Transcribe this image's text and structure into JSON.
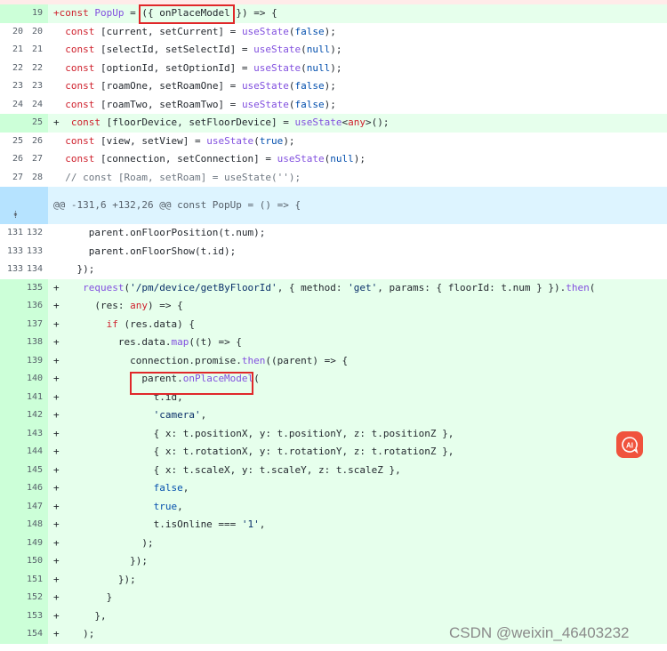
{
  "lines_before": [
    {
      "old": "",
      "new": "19",
      "type": "add",
      "segs": [
        [
          "+const ",
          "kw"
        ],
        [
          "PopUp",
          "fn"
        ],
        [
          " = ",
          ""
        ],
        [
          "({ onPlaceModel })",
          ""
        ],
        [
          " => {",
          ""
        ]
      ]
    },
    {
      "old": "20",
      "new": "20",
      "type": "ctx",
      "segs": [
        [
          "  const ",
          "kw"
        ],
        [
          "[current, setCurrent] = ",
          ""
        ],
        [
          "useState",
          "fn"
        ],
        [
          "(",
          ""
        ],
        [
          "false",
          "bl"
        ],
        [
          ");",
          ""
        ]
      ]
    },
    {
      "old": "21",
      "new": "21",
      "type": "ctx",
      "segs": [
        [
          "  const ",
          "kw"
        ],
        [
          "[selectId, setSelectId] = ",
          ""
        ],
        [
          "useState",
          "fn"
        ],
        [
          "(",
          ""
        ],
        [
          "null",
          "bl"
        ],
        [
          ");",
          ""
        ]
      ]
    },
    {
      "old": "22",
      "new": "22",
      "type": "ctx",
      "segs": [
        [
          "  const ",
          "kw"
        ],
        [
          "[optionId, setOptionId] = ",
          ""
        ],
        [
          "useState",
          "fn"
        ],
        [
          "(",
          ""
        ],
        [
          "null",
          "bl"
        ],
        [
          ");",
          ""
        ]
      ]
    },
    {
      "old": "23",
      "new": "23",
      "type": "ctx",
      "segs": [
        [
          "  const ",
          "kw"
        ],
        [
          "[roamOne, setRoamOne] = ",
          ""
        ],
        [
          "useState",
          "fn"
        ],
        [
          "(",
          ""
        ],
        [
          "false",
          "bl"
        ],
        [
          ");",
          ""
        ]
      ]
    },
    {
      "old": "24",
      "new": "24",
      "type": "ctx",
      "segs": [
        [
          "  const ",
          "kw"
        ],
        [
          "[roamTwo, setRoamTwo] = ",
          ""
        ],
        [
          "useState",
          "fn"
        ],
        [
          "(",
          ""
        ],
        [
          "false",
          "bl"
        ],
        [
          ");",
          ""
        ]
      ]
    },
    {
      "old": "",
      "new": "25",
      "type": "add",
      "segs": [
        [
          "+ ",
          ""
        ],
        [
          " const ",
          "kw"
        ],
        [
          "[floorDevice, setFloorDevice] = ",
          ""
        ],
        [
          "useState",
          "fn"
        ],
        [
          "<",
          ""
        ],
        [
          "any",
          "kw"
        ],
        [
          ">();",
          ""
        ]
      ]
    },
    {
      "old": "25",
      "new": "26",
      "type": "ctx",
      "segs": [
        [
          "  const ",
          "kw"
        ],
        [
          "[view, setView] = ",
          ""
        ],
        [
          "useState",
          "fn"
        ],
        [
          "(",
          ""
        ],
        [
          "true",
          "bl"
        ],
        [
          ");",
          ""
        ]
      ]
    },
    {
      "old": "26",
      "new": "27",
      "type": "ctx",
      "segs": [
        [
          "  const ",
          "kw"
        ],
        [
          "[connection, setConnection] = ",
          ""
        ],
        [
          "useState",
          "fn"
        ],
        [
          "(",
          ""
        ],
        [
          "null",
          "bl"
        ],
        [
          ");",
          ""
        ]
      ]
    },
    {
      "old": "27",
      "new": "28",
      "type": "ctx",
      "segs": [
        [
          "  // const [Roam, setRoam] = useState('');",
          "cm"
        ]
      ]
    }
  ],
  "hunk_header": "@@ -131,6 +132,26 @@ const PopUp = () => {",
  "lines_after": [
    {
      "old": "131",
      "new": "132",
      "type": "ctx",
      "segs": [
        [
          "      parent.onFloorPosition(t.num);",
          ""
        ]
      ]
    },
    {
      "old": "133",
      "new": "133",
      "type": "ctx",
      "segs": [
        [
          "      parent.onFloorShow(t.id);",
          ""
        ]
      ]
    },
    {
      "old": "133",
      "new": "134",
      "type": "ctx",
      "segs": [
        [
          "    });",
          ""
        ]
      ]
    },
    {
      "old": "",
      "new": "135",
      "type": "add",
      "segs": [
        [
          "+    ",
          ""
        ],
        [
          "request",
          "fn"
        ],
        [
          "(",
          ""
        ],
        [
          "'/pm/device/getByFloorId'",
          "str"
        ],
        [
          ", { method: ",
          ""
        ],
        [
          "'get'",
          "str"
        ],
        [
          ", params: { floorId: t.num } }).",
          ""
        ],
        [
          "then",
          "fn"
        ],
        [
          "(",
          ""
        ]
      ]
    },
    {
      "old": "",
      "new": "136",
      "type": "add",
      "segs": [
        [
          "+      (res: ",
          ""
        ],
        [
          "any",
          "kw"
        ],
        [
          ") => {",
          ""
        ]
      ]
    },
    {
      "old": "",
      "new": "137",
      "type": "add",
      "segs": [
        [
          "+        ",
          ""
        ],
        [
          "if",
          "kw"
        ],
        [
          " (res.data) {",
          ""
        ]
      ]
    },
    {
      "old": "",
      "new": "138",
      "type": "add",
      "segs": [
        [
          "+          res.data.",
          ""
        ],
        [
          "map",
          "fn"
        ],
        [
          "((t) => {",
          ""
        ]
      ]
    },
    {
      "old": "",
      "new": "139",
      "type": "add",
      "segs": [
        [
          "+            connection.promise.",
          ""
        ],
        [
          "then",
          "fn"
        ],
        [
          "((parent) => {",
          ""
        ]
      ]
    },
    {
      "old": "",
      "new": "140",
      "type": "add",
      "segs": [
        [
          "+              parent.",
          ""
        ],
        [
          "onPlaceModel",
          "fn"
        ],
        [
          "(",
          ""
        ]
      ]
    },
    {
      "old": "",
      "new": "141",
      "type": "add",
      "segs": [
        [
          "+                t.id,",
          ""
        ]
      ]
    },
    {
      "old": "",
      "new": "142",
      "type": "add",
      "segs": [
        [
          "+                ",
          ""
        ],
        [
          "'camera'",
          "str"
        ],
        [
          ",",
          ""
        ]
      ]
    },
    {
      "old": "",
      "new": "143",
      "type": "add",
      "segs": [
        [
          "+                { x: t.positionX, y: t.positionY, z: t.positionZ },",
          ""
        ]
      ]
    },
    {
      "old": "",
      "new": "144",
      "type": "add",
      "segs": [
        [
          "+                { x: t.rotationX, y: t.rotationY, z: t.rotationZ },",
          ""
        ]
      ]
    },
    {
      "old": "",
      "new": "145",
      "type": "add",
      "segs": [
        [
          "+                { x: t.scaleX, y: t.scaleY, z: t.scaleZ },",
          ""
        ]
      ]
    },
    {
      "old": "",
      "new": "146",
      "type": "add",
      "segs": [
        [
          "+                ",
          ""
        ],
        [
          "false",
          "bl"
        ],
        [
          ",",
          ""
        ]
      ]
    },
    {
      "old": "",
      "new": "147",
      "type": "add",
      "segs": [
        [
          "+                ",
          ""
        ],
        [
          "true",
          "bl"
        ],
        [
          ",",
          ""
        ]
      ]
    },
    {
      "old": "",
      "new": "148",
      "type": "add",
      "segs": [
        [
          "+                t.isOnline === ",
          ""
        ],
        [
          "'1'",
          "str"
        ],
        [
          ",",
          ""
        ]
      ]
    },
    {
      "old": "",
      "new": "149",
      "type": "add",
      "segs": [
        [
          "+              );",
          ""
        ]
      ]
    },
    {
      "old": "",
      "new": "150",
      "type": "add",
      "segs": [
        [
          "+            });",
          ""
        ]
      ]
    },
    {
      "old": "",
      "new": "151",
      "type": "add",
      "segs": [
        [
          "+          });",
          ""
        ]
      ]
    },
    {
      "old": "",
      "new": "152",
      "type": "add",
      "segs": [
        [
          "+        }",
          ""
        ]
      ]
    },
    {
      "old": "",
      "new": "153",
      "type": "add",
      "segs": [
        [
          "+      },",
          ""
        ]
      ]
    },
    {
      "old": "",
      "new": "154",
      "type": "add",
      "segs": [
        [
          "+    );",
          ""
        ]
      ]
    }
  ],
  "ai_badge": {
    "label": "AI",
    "color": "#f0533d"
  },
  "watermark": "CSDN @weixin_46403232",
  "colors": {
    "added_bg": "#e6ffec",
    "added_gutter": "#ccffd8",
    "hunk_bg": "#ddf4ff",
    "highlight": "#e0282a"
  }
}
